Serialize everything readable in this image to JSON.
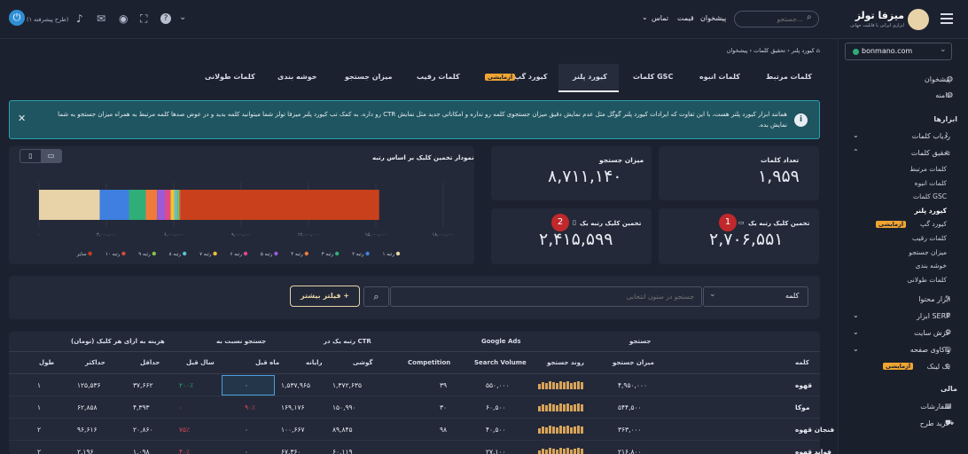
{
  "brand": {
    "name": "میزفا تولز",
    "tagline": "ابزاری ایرانی با قابلیت جهانی"
  },
  "topnav": {
    "search_placeholder": "جستجو...",
    "links": [
      "پیشخوان",
      "قیمت",
      "تماس"
    ]
  },
  "topright": {
    "workspace_hint": "(طرح پیشرفته ۱)"
  },
  "breadcrumb": [
    "پیشخوان",
    "تحقیق کلمات",
    "کیورد پلنر"
  ],
  "domain_select": "bonmano.com",
  "tabs": [
    "کلمات مرتبط",
    "کلمات انبوه",
    "کلمات GSC",
    "کیورد پلنر",
    "کیورد گپ",
    "کلمات رقیب",
    "میزان جستجو",
    "خوشه بندی",
    "کلمات طولانی"
  ],
  "tab_badge": "آزمایشی",
  "notice": "همانند ابزار کیورد پلنر هست، با این تفاوت که ایرادات کیورد پلنر گوگل مثل عدم نمایش دقیق میزان جستجوی کلمه رو نداره و امکاناتی جدید مثل نمایش CTR رو داره. به کمک تب کیورد پلنر میزفا تولز شما میتوانید کلمه بدید و در عوض صدها کلمه مرتبط به همراه میزان جستجو به شما نمایش بده.",
  "stats": {
    "keywords_count": {
      "label": "تعداد کلمات",
      "value": "۱,۹۵۹"
    },
    "search_volume": {
      "label": "میزان جستجو",
      "value": "۸,۷۱۱,۱۴۰"
    },
    "click_desktop": {
      "label": "تخمین کلیک رتبه یک",
      "value": "۲,۷۰۶,۵۵۱",
      "marker": "1"
    },
    "click_mobile": {
      "label": "تخمین کلیک رتبه یک",
      "value": "۲,۴۱۵,۵۹۹",
      "marker": "2"
    }
  },
  "chart_data": {
    "type": "bar",
    "title": "نمودار تخمین کلیک بر اساس رتبه",
    "xticks": [
      "۰",
      "۳,۰۰۰,۰۰۰",
      "۶,۰۰۰,۰۰۰",
      "۹,۰۰۰,۰۰۰",
      "۱۲,۰۰۰,۰۰۰",
      "۱۵,۰۰۰,۰۰۰",
      "۱۸,۰۰۰,۰۰۰"
    ],
    "xlim": [
      0,
      18000000
    ],
    "series": [
      {
        "name": "رتبه ۱",
        "value": 2706551,
        "color": "#e8d3a8"
      },
      {
        "name": "رتبه ۲",
        "value": 1300000,
        "color": "#3f7fe0"
      },
      {
        "name": "رتبه ۳",
        "value": 750000,
        "color": "#2fae78"
      },
      {
        "name": "رتبه ۴",
        "value": 500000,
        "color": "#f07a3a"
      },
      {
        "name": "رتبه ۵",
        "value": 350000,
        "color": "#9a5cd6"
      },
      {
        "name": "رتبه ۶",
        "value": 250000,
        "color": "#e04a8a"
      },
      {
        "name": "رتبه ۷",
        "value": 180000,
        "color": "#f2c230"
      },
      {
        "name": "رتبه ۸",
        "value": 130000,
        "color": "#5ac0d8"
      },
      {
        "name": "رتبه ۹",
        "value": 100000,
        "color": "#8bc34a"
      },
      {
        "name": "رتبه ۱۰",
        "value": 80000,
        "color": "#d84a3a"
      },
      {
        "name": "سایر",
        "value": 8800000,
        "color": "#c9401c"
      }
    ]
  },
  "filter": {
    "column_select": "کلمه",
    "search_placeholder": "جستجو در ستون انتخابی",
    "more_filters": "فیلتر بیشتر"
  },
  "table": {
    "groups": [
      "جستجو",
      "Google Ads",
      "رتبه یک در CTR",
      "جستجو نسبت به",
      "هزینه به ازای هر کلیک (تومان)"
    ],
    "headers": [
      "کلمه",
      "میزان جستجو",
      "روند جستجو",
      "Search Volume",
      "Competition",
      "گوشی",
      "رایانه",
      "ماه قبل",
      "سال قبل",
      "حداقل",
      "حداکثر",
      "طول"
    ],
    "rows": [
      {
        "keyword": "قهوه",
        "volume": "۴,۹۵۰,۰۰۰",
        "sv": "۵۵۰,۰۰۰",
        "comp": "۳۹",
        "mobile": "۱,۳۷۲,۶۳۵",
        "desktop": "۱,۵۳۷,۹۶۵",
        "month": "۰",
        "year": "۲۰۰٪",
        "min": "۳۷,۶۶۲",
        "max": "۱۲۵,۵۳۶",
        "len": "۱"
      },
      {
        "keyword": "موکا",
        "volume": "۵۴۴,۵۰۰",
        "sv": "۶۰,۵۰۰",
        "comp": "۳۰",
        "mobile": "۱۵۰,۹۹۰",
        "desktop": "۱۶۹,۱۷۶",
        "month": "۹۰٪",
        "year": "۰",
        "min": "۴,۳۹۳",
        "max": "۶۲,۸۵۸",
        "len": "۱"
      },
      {
        "keyword": "فنجان قهوه",
        "volume": "۳۶۳,۰۰۰",
        "sv": "۴۰,۵۰۰",
        "comp": "۹۸",
        "mobile": "۸۹,۸۴۵",
        "desktop": "۱۰۰,۶۶۷",
        "month": "۰",
        "year": "۷۵٪",
        "min": "۲۰,۸۶۰",
        "max": "۹۶,۶۱۶",
        "len": "۲"
      },
      {
        "keyword": "فواید قهوه",
        "volume": "۲۱۶,۸۰۰",
        "sv": "۲۷,۱۰۰",
        "comp": "",
        "mobile": "۶۰,۱۱۹",
        "desktop": "۶۷,۳۶۰",
        "month": "۰",
        "year": "۴۰٪",
        "min": "۱,۰۹۸",
        "max": "۲,۱۹۶",
        "len": "۲"
      }
    ]
  },
  "sidebar": {
    "items": [
      {
        "label": "پیشخوان",
        "icon": "globe-icon"
      },
      {
        "label": "دامنه",
        "icon": "globe-icon"
      }
    ],
    "section_tools": "ابزارها",
    "tools": [
      {
        "label": "ردیاب کلمات",
        "icon": "chart-icon"
      },
      {
        "label": "تحقیق کلمات",
        "icon": "search-icon"
      }
    ],
    "research_sub": [
      "کلمات مرتبط",
      "کلمات انبوه",
      "کلمات GSC",
      "کیورد پلنر",
      "کیورد گپ",
      "کلمات رقیب",
      "میزان جستجو",
      "خوشه بندی",
      "کلمات طولانی"
    ],
    "more_tools": [
      {
        "label": "ابزار محتوا",
        "icon": "pen-icon"
      },
      {
        "label": "ابزار SERP",
        "icon": "trophy-icon"
      },
      {
        "label": "خزش سایت",
        "icon": "crawl-icon"
      },
      {
        "label": "واکاوی صفحه",
        "icon": "audit-icon"
      },
      {
        "label": "بک لینک",
        "icon": "link-icon"
      }
    ],
    "section_finance": "مالی",
    "finance": [
      "سفارشات",
      "خرید طرح"
    ]
  }
}
